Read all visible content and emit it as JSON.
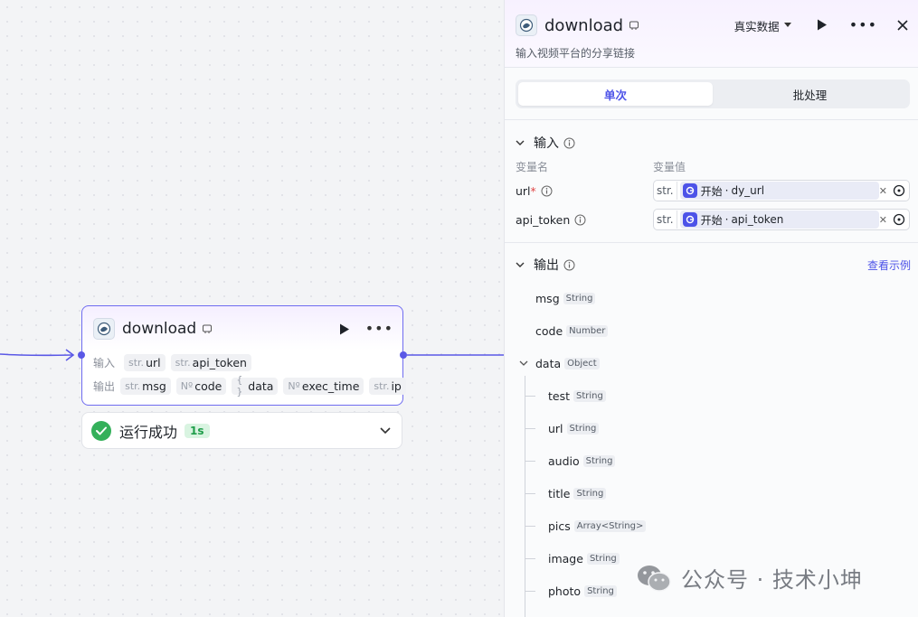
{
  "node": {
    "title": "download",
    "input_label": "输入",
    "output_label": "输出",
    "inputs": [
      {
        "type": "str.",
        "name": "url"
      },
      {
        "type": "str.",
        "name": "api_token"
      }
    ],
    "outputs": [
      {
        "type": "str.",
        "name": "msg"
      },
      {
        "type": "Nº",
        "name": "code"
      },
      {
        "type": "{ }",
        "name": "data"
      },
      {
        "type": "Nº",
        "name": "exec_time"
      },
      {
        "type": "str.",
        "name": "ip"
      }
    ]
  },
  "run": {
    "status": "运行成功",
    "duration": "1s"
  },
  "panel": {
    "title": "download",
    "data_mode": "真实数据",
    "description": "输入视频平台的分享链接",
    "tabs": [
      {
        "label": "单次",
        "active": true
      },
      {
        "label": "批处理",
        "active": false
      }
    ],
    "input_section": "输入",
    "col_var_name": "变量名",
    "col_var_value": "变量值",
    "params": [
      {
        "name": "url",
        "required": "*",
        "type": "str.",
        "source": "开始",
        "separator": "·",
        "variable": "dy_url"
      },
      {
        "name": "api_token",
        "required": "",
        "type": "str.",
        "source": "开始",
        "separator": "·",
        "variable": "api_token"
      }
    ],
    "output_section": "输出",
    "view_example": "查看示例",
    "outputs": [
      {
        "name": "msg",
        "type": "String"
      },
      {
        "name": "code",
        "type": "Number"
      },
      {
        "name": "data",
        "type": "Object"
      }
    ],
    "data_children": [
      {
        "name": "test",
        "type": "String"
      },
      {
        "name": "url",
        "type": "String"
      },
      {
        "name": "audio",
        "type": "String"
      },
      {
        "name": "title",
        "type": "String"
      },
      {
        "name": "pics",
        "type": "Array<String>"
      },
      {
        "name": "image",
        "type": "String"
      },
      {
        "name": "photo",
        "type": "String"
      }
    ]
  },
  "watermark": {
    "text": "公众号 · 技术小坤"
  },
  "colors": {
    "accent": "#4d53e8",
    "node_border": "#6f6cf0",
    "success": "#34b05a"
  }
}
